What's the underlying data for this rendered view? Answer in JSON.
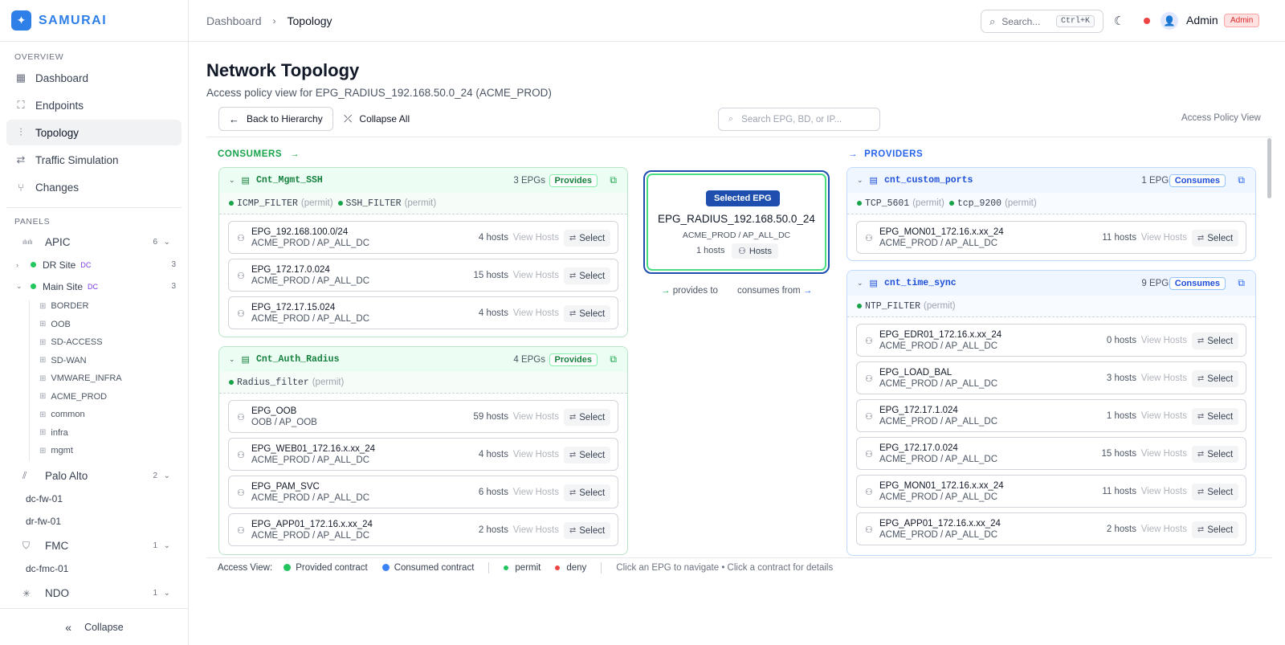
{
  "brand": {
    "name": "SAMURAI",
    "color": "#2f7fe8"
  },
  "sidebar": {
    "overview_label": "OVERVIEW",
    "nav": [
      {
        "label": "Dashboard",
        "icon": "dashboard-icon"
      },
      {
        "label": "Endpoints",
        "icon": "endpoints-icon"
      },
      {
        "label": "Topology",
        "icon": "topology-icon",
        "active": true
      },
      {
        "label": "Traffic Simulation",
        "icon": "traffic-icon"
      },
      {
        "label": "Changes",
        "icon": "changes-icon"
      }
    ],
    "panels_label": "PANELS",
    "apic": {
      "label": "APIC",
      "count": "6",
      "icon_text": "cisco"
    },
    "sites": [
      {
        "label": "DR Site",
        "tag": "DC",
        "count": "3"
      },
      {
        "label": "Main Site",
        "tag": "DC",
        "count": "3"
      }
    ],
    "tenants": [
      "BORDER",
      "OOB",
      "SD-ACCESS",
      "SD-WAN",
      "VMWARE_INFRA",
      "ACME_PROD",
      "common",
      "infra",
      "mgmt"
    ],
    "paloalto": {
      "label": "Palo Alto",
      "count": "2",
      "devices": [
        "dc-fw-01",
        "dr-fw-01"
      ]
    },
    "fmc": {
      "label": "FMC",
      "count": "1",
      "devices": [
        "dc-fmc-01"
      ]
    },
    "ndo": {
      "label": "NDO",
      "count": "1"
    },
    "collapse_label": "Collapse"
  },
  "header": {
    "breadcrumb": [
      "Dashboard",
      "Topology"
    ],
    "search_placeholder": "Search...",
    "search_shortcut": "Ctrl+K",
    "user": "Admin",
    "role": "Admin"
  },
  "page": {
    "title": "Network Topology",
    "subtitle": "Access policy view for EPG_RADIUS_192.168.50.0_24 (ACME_PROD)",
    "back_label": "Back to Hierarchy",
    "collapse_label": "Collapse All",
    "search_placeholder": "Search EPG, BD, or IP...",
    "view_label": "Access Policy View"
  },
  "consumers": {
    "heading": "CONSUMERS",
    "contracts": [
      {
        "name": "Cnt_Mgmt_SSH",
        "epg_count": "3 EPGs",
        "role": "Provides",
        "filters": [
          {
            "name": "ICMP_FILTER",
            "action": "(permit)"
          },
          {
            "name": "SSH_FILTER",
            "action": "(permit)"
          }
        ],
        "epgs": [
          {
            "name": "EPG_192.168.100.0/24",
            "path": "ACME_PROD / AP_ALL_DC",
            "hosts": "4 hosts"
          },
          {
            "name": "EPG_172.17.0.024",
            "path": "ACME_PROD / AP_ALL_DC",
            "hosts": "15 hosts"
          },
          {
            "name": "EPG_172.17.15.024",
            "path": "ACME_PROD / AP_ALL_DC",
            "hosts": "4 hosts"
          }
        ]
      },
      {
        "name": "Cnt_Auth_Radius",
        "epg_count": "4 EPGs",
        "role": "Provides",
        "filters": [
          {
            "name": "Radius_filter",
            "action": "(permit)"
          }
        ],
        "epgs": [
          {
            "name": "EPG_OOB",
            "path": "OOB / AP_OOB",
            "hosts": "59 hosts"
          },
          {
            "name": "EPG_WEB01_172.16.x.xx_24",
            "path": "ACME_PROD / AP_ALL_DC",
            "hosts": "4 hosts"
          },
          {
            "name": "EPG_PAM_SVC",
            "path": "ACME_PROD / AP_ALL_DC",
            "hosts": "6 hosts"
          },
          {
            "name": "EPG_APP01_172.16.x.xx_24",
            "path": "ACME_PROD / AP_ALL_DC",
            "hosts": "2 hosts"
          }
        ]
      }
    ]
  },
  "selected": {
    "badge": "Selected EPG",
    "name": "EPG_RADIUS_192.168.50.0_24",
    "path": "ACME_PROD / AP_ALL_DC",
    "hosts": "1 hosts",
    "hosts_button": "Hosts",
    "provides_to": "provides to",
    "consumes_from": "consumes from"
  },
  "providers": {
    "heading": "PROVIDERS",
    "contracts": [
      {
        "name": "cnt_custom_ports",
        "epg_count": "1 EPGs",
        "role": "Consumes",
        "filters": [
          {
            "name": "TCP_5601",
            "action": "(permit)"
          },
          {
            "name": "tcp_9200",
            "action": "(permit)"
          }
        ],
        "epgs": [
          {
            "name": "EPG_MON01_172.16.x.xx_24",
            "path": "ACME_PROD / AP_ALL_DC",
            "hosts": "11 hosts"
          }
        ]
      },
      {
        "name": "cnt_time_sync",
        "epg_count": "9 EPGs",
        "role": "Consumes",
        "filters": [
          {
            "name": "NTP_FILTER",
            "action": "(permit)"
          }
        ],
        "epgs": [
          {
            "name": "EPG_EDR01_172.16.x.xx_24",
            "path": "ACME_PROD / AP_ALL_DC",
            "hosts": "0 hosts"
          },
          {
            "name": "EPG_LOAD_BAL",
            "path": "ACME_PROD / AP_ALL_DC",
            "hosts": "3 hosts"
          },
          {
            "name": "EPG_172.17.1.024",
            "path": "ACME_PROD / AP_ALL_DC",
            "hosts": "1 hosts"
          },
          {
            "name": "EPG_172.17.0.024",
            "path": "ACME_PROD / AP_ALL_DC",
            "hosts": "15 hosts"
          },
          {
            "name": "EPG_MON01_172.16.x.xx_24",
            "path": "ACME_PROD / AP_ALL_DC",
            "hosts": "11 hosts"
          },
          {
            "name": "EPG_APP01_172.16.x.xx_24",
            "path": "ACME_PROD / AP_ALL_DC",
            "hosts": "2 hosts"
          }
        ]
      }
    ]
  },
  "epg_actions": {
    "view_hosts": "View Hosts",
    "select": "Select"
  },
  "legend": {
    "title": "Access View:",
    "provided": "Provided contract",
    "consumed": "Consumed contract",
    "permit": "permit",
    "deny": "deny",
    "hint": "Click an EPG to navigate • Click a contract for details",
    "colors": {
      "provided": "#22c55e",
      "consumed": "#3b82f6",
      "permit": "#22c55e",
      "deny": "#ef4444"
    }
  }
}
